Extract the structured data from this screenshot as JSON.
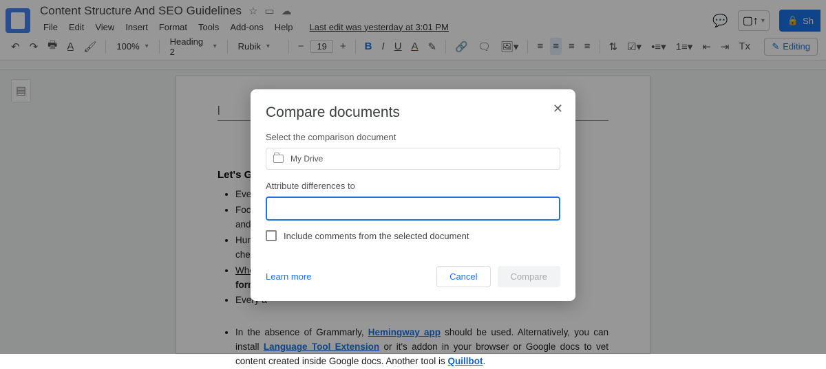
{
  "header": {
    "title": "Content Structure And SEO Guidelines",
    "last_edit": "Last edit was yesterday at 3:01 PM",
    "share_label": "Sh"
  },
  "menubar": [
    "File",
    "Edit",
    "View",
    "Insert",
    "Format",
    "Tools",
    "Add-ons",
    "Help"
  ],
  "toolbar": {
    "zoom": "100%",
    "style": "Heading 2",
    "font": "Rubik",
    "fontsize": "19",
    "editing_label": "Editing"
  },
  "doc": {
    "section_title": "Let's Get T",
    "bullets": [
      "Every a",
      "Focus c — and fan",
      "Humou — check a",
      "When s — format",
      "Every a"
    ],
    "para_a": "In the absence of Grammarly, ",
    "link1": "Hemingway app",
    "para_b": " should be used. Alternatively, you can install ",
    "link2": "Language Tool Extension",
    "para_c": " or it's addon in your browser or Google docs to vet content created inside Google docs. Another tool is ",
    "link3": "Quillbot",
    "para_d": "."
  },
  "modal": {
    "title": "Compare documents",
    "select_label": "Select the comparison document",
    "drive_label": "My Drive",
    "attr_label": "Attribute differences to",
    "attr_value": "",
    "checkbox_label": "Include comments from the selected document",
    "learn_more": "Learn more",
    "cancel": "Cancel",
    "compare": "Compare"
  }
}
